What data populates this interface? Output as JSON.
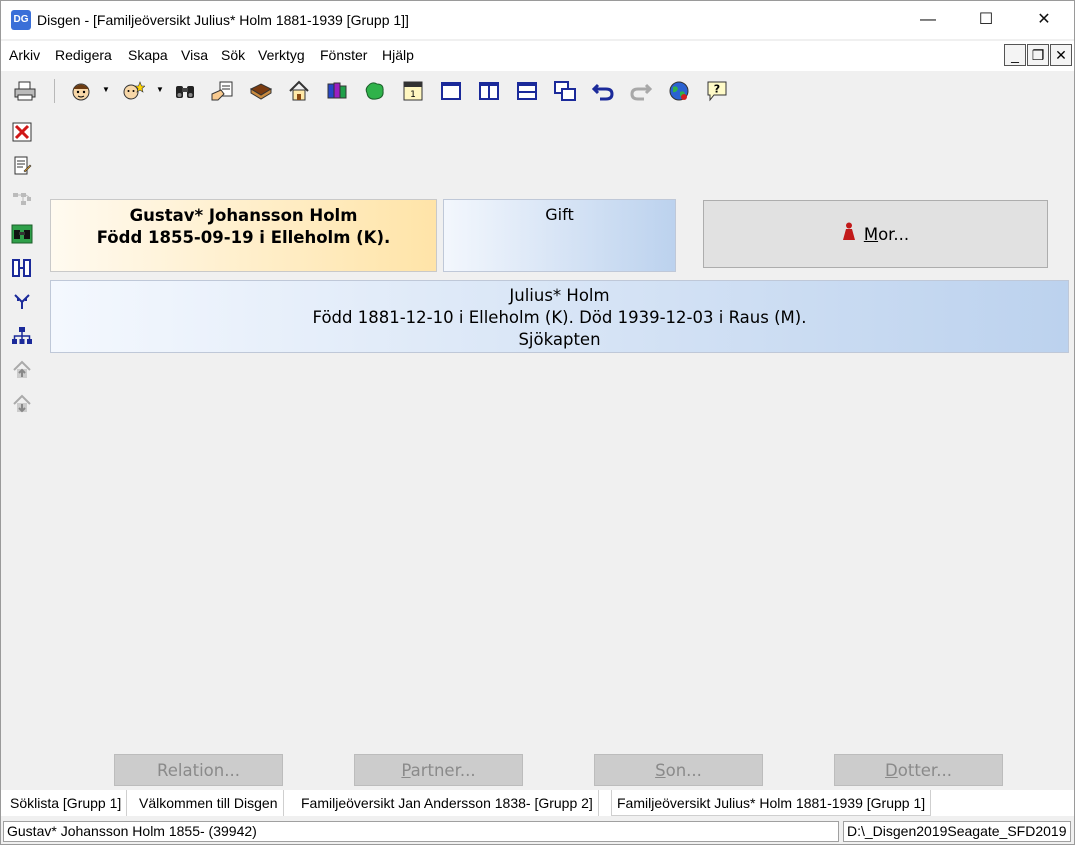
{
  "window": {
    "app_icon_text": "DG",
    "title": "Disgen - [Familjeöversikt Julius* Holm 1881-1939 [Grupp 1]]",
    "minimize": "—",
    "maximize": "☐",
    "close": "✕"
  },
  "menu": {
    "items": [
      "Arkiv",
      "Redigera",
      "Skapa",
      "Visa",
      "Sök",
      "Verktyg",
      "Fönster",
      "Hjälp"
    ],
    "mdi_minimize": "_",
    "mdi_restore": "❐",
    "mdi_close": "✕"
  },
  "toolbar": {
    "icons": [
      "printer-icon",
      "face-icon",
      "face-star-icon",
      "binoculars-icon",
      "hand-document-icon",
      "book-icon",
      "house-icon",
      "books-icon",
      "map-icon",
      "calendar-icon",
      "window-icon",
      "window-split-icon",
      "window-rows-icon",
      "windows-cascade-icon",
      "undo-icon",
      "redo-icon",
      "globe-icon",
      "help-icon"
    ],
    "calendar_label": "Jan\n1",
    "help_label": "?"
  },
  "sidebar": {
    "icons": [
      "close-red-icon",
      "document-edit-icon",
      "tree-disabled-icon",
      "binoculars-grid-icon",
      "columns-icon",
      "descendant-tree-icon",
      "org-chart-icon",
      "house-up-icon",
      "house-down-icon"
    ]
  },
  "family": {
    "father": {
      "name": "Gustav* Johansson Holm",
      "born": "Född 1855-09-19 i Elleholm (K)."
    },
    "relation": "Gift",
    "mother_button": {
      "label_mnemonic": "M",
      "label_rest": "or..."
    },
    "child": {
      "name": "Julius* Holm",
      "life": "Född 1881-12-10 i Elleholm (K). Död 1939-12-03 i Raus (M).",
      "occupation": "Sjökapten"
    }
  },
  "bottom_buttons": [
    {
      "mnemonic": "",
      "label": "Relation..."
    },
    {
      "mnemonic": "P",
      "label": "artner..."
    },
    {
      "mnemonic": "S",
      "label": "on..."
    },
    {
      "mnemonic": "D",
      "label": "otter..."
    }
  ],
  "tabs": [
    "Söklista [Grupp 1]",
    "Välkommen till Disgen",
    "Familjeöversikt Jan Andersson 1838- [Grupp 2]",
    "Familjeöversikt Julius* Holm 1881-1939 [Grupp 1]"
  ],
  "status": {
    "left": "Gustav* Johansson Holm 1855- (39942)",
    "right": "D:\\_Disgen2019Seagate_SFD2019"
  }
}
